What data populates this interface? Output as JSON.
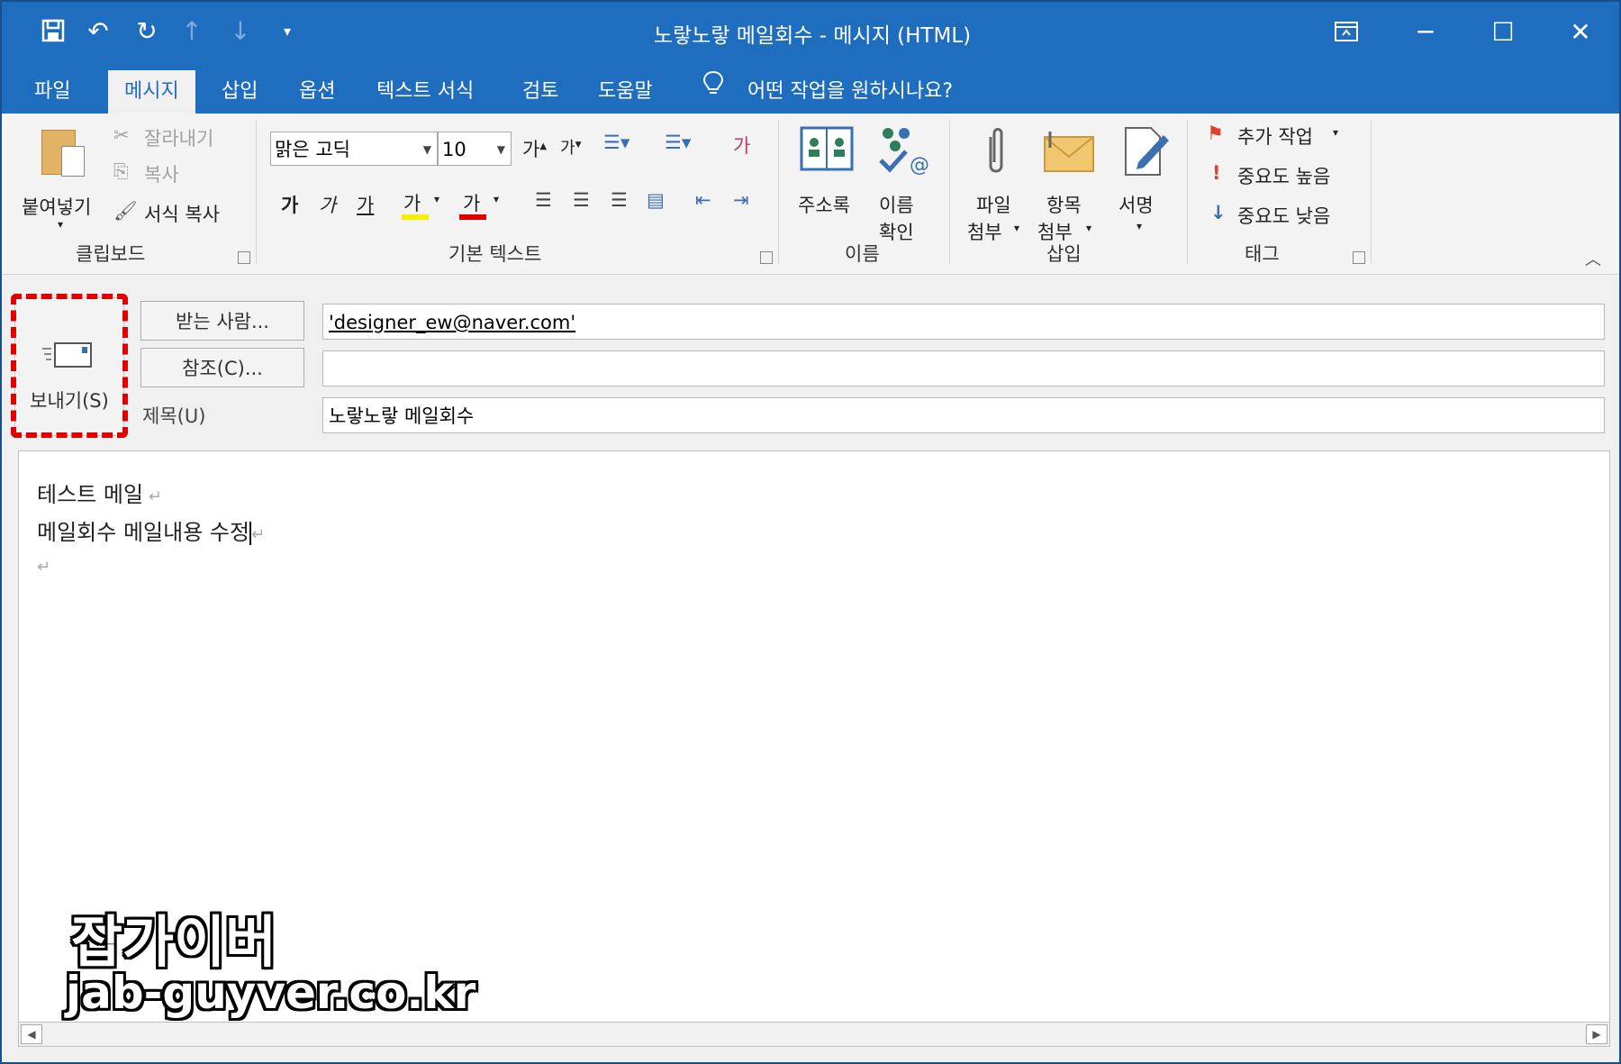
{
  "window": {
    "title": "노랗노랗 메일회수  -  메시지 (HTML)"
  },
  "tabs": [
    "파일",
    "메시지",
    "삽입",
    "옵션",
    "텍스트 서식",
    "검토",
    "도움말"
  ],
  "tell_me": "어떤 작업을 원하시나요?",
  "ribbon": {
    "clipboard": {
      "paste": "붙여넣기",
      "cut": "잘라내기",
      "copy": "복사",
      "format_painter": "서식 복사",
      "label": "클립보드"
    },
    "basic_text": {
      "font": "맑은 고딕",
      "size": "10",
      "bold": "가",
      "italic": "가",
      "underline": "가",
      "highlight": "가",
      "font_color": "가",
      "label": "기본 텍스트"
    },
    "names": {
      "address_book": "주소록",
      "check_names_1": "이름",
      "check_names_2": "확인",
      "label": "이름"
    },
    "include": {
      "attach_file_1": "파일",
      "attach_file_2": "첨부",
      "attach_item_1": "항목",
      "attach_item_2": "첨부",
      "signature": "서명",
      "label": "삽입"
    },
    "tags": {
      "follow_up": "추가 작업",
      "high_importance": "중요도 높음",
      "low_importance": "중요도 낮음",
      "label": "태그"
    }
  },
  "compose": {
    "send": "보내기(S)",
    "to_button": "받는 사람...",
    "cc_button": "참조(C)...",
    "subject_label": "제목(U)",
    "to_value": "'designer_ew@naver.com'",
    "cc_value": "",
    "subject_value": "노랗노랗 메일회수"
  },
  "body": {
    "line1": "테스트 메일",
    "line2": "메일회수 메일내용 수정"
  },
  "watermark": {
    "name": "잡가이버",
    "url": "jab-guyver.co.kr"
  },
  "colors": {
    "accent": "#1f6dbf",
    "highlight_red": "#e00000"
  }
}
